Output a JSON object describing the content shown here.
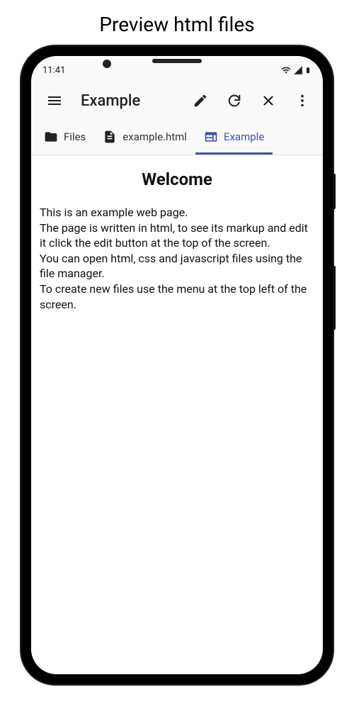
{
  "page_caption": "Preview html files",
  "status": {
    "time": "11:41"
  },
  "appbar": {
    "title": "Example"
  },
  "tabs": {
    "files": {
      "label": "Files"
    },
    "file": {
      "label": "example.html"
    },
    "preview": {
      "label": "Example"
    }
  },
  "content": {
    "heading": "Welcome",
    "body": "This is an example web page.\nThe page is written in html, to see its markup and edit it click the edit button at the top of the screen.\nYou can open html, css and javascript files using the file manager.\nTo create new files use the menu at the top left of the screen."
  }
}
